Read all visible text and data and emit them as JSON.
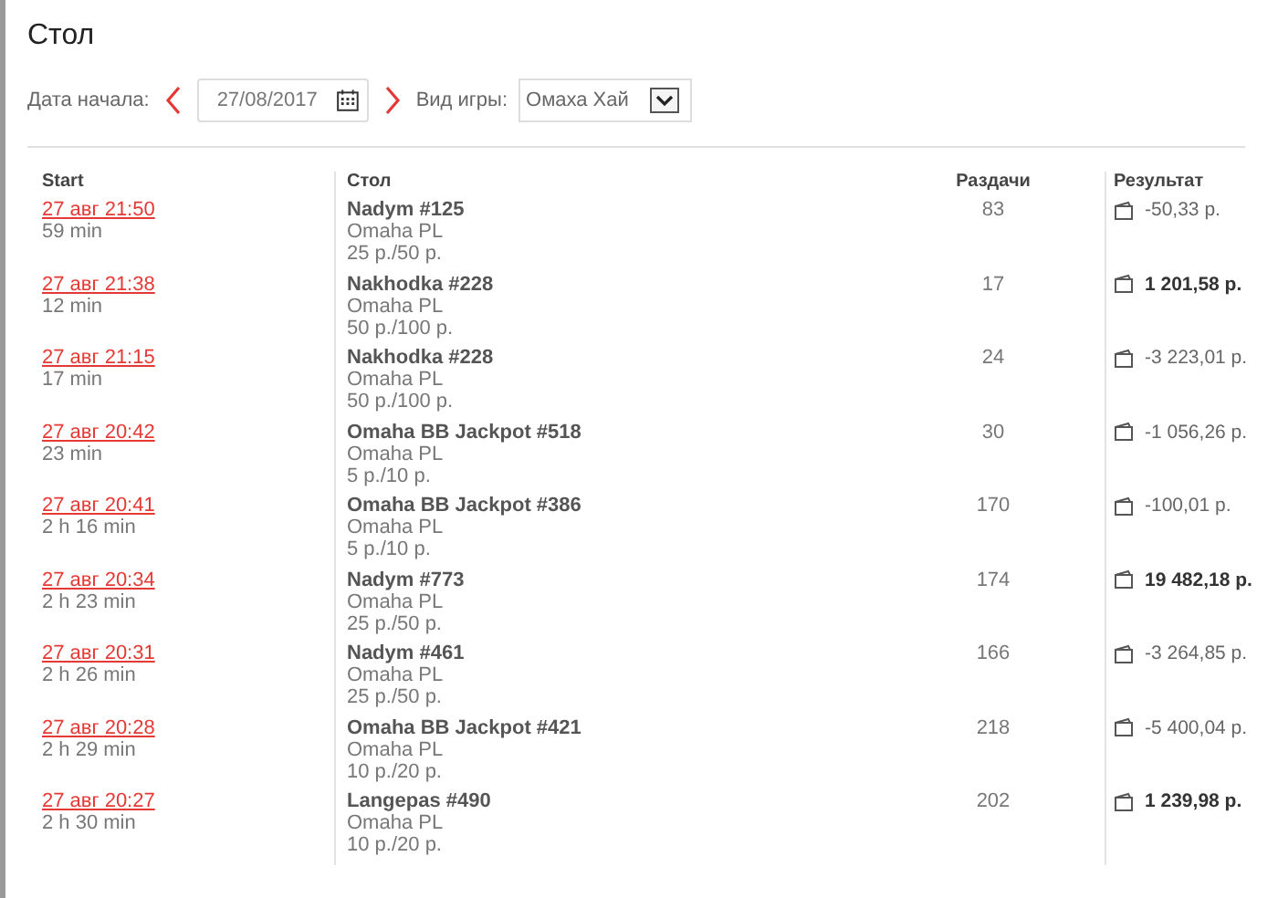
{
  "title": "Стол",
  "filters": {
    "date_label": "Дата начала:",
    "date": "27/08/2017",
    "game_label": "Вид игры:",
    "game": "Омаха Хай"
  },
  "table": {
    "columns": [
      "Start",
      "Стол",
      "Раздачи",
      "Результат"
    ],
    "rows": [
      {
        "start": "27 авг 21:50",
        "duration": "59 min",
        "table": "Nadym #125",
        "game": "Omaha PL",
        "stakes": "25 р./50 р.",
        "hands": "83",
        "result": "-50,33 р.",
        "positive": false
      },
      {
        "start": "27 авг 21:38",
        "duration": "12 min",
        "table": "Nakhodka #228",
        "game": "Omaha PL",
        "stakes": "50 р./100 р.",
        "hands": "17",
        "result": "1 201,58 р.",
        "positive": true
      },
      {
        "start": "27 авг 21:15",
        "duration": "17 min",
        "table": "Nakhodka #228",
        "game": "Omaha PL",
        "stakes": "50 р./100 р.",
        "hands": "24",
        "result": "-3 223,01 р.",
        "positive": false
      },
      {
        "start": "27 авг 20:42",
        "duration": "23 min",
        "table": "Omaha BB Jackpot #518",
        "game": "Omaha PL",
        "stakes": "5 р./10 р.",
        "hands": "30",
        "result": "-1 056,26 р.",
        "positive": false
      },
      {
        "start": "27 авг 20:41",
        "duration": "2 h 16 min",
        "table": "Omaha BB Jackpot #386",
        "game": "Omaha PL",
        "stakes": "5 р./10 р.",
        "hands": "170",
        "result": "-100,01 р.",
        "positive": false
      },
      {
        "start": "27 авг 20:34",
        "duration": "2 h 23 min",
        "table": "Nadym #773",
        "game": "Omaha PL",
        "stakes": "25 р./50 р.",
        "hands": "174",
        "result": "19 482,18 р.",
        "positive": true
      },
      {
        "start": "27 авг 20:31",
        "duration": "2 h 26 min",
        "table": "Nadym #461",
        "game": "Omaha PL",
        "stakes": "25 р./50 р.",
        "hands": "166",
        "result": "-3 264,85 р.",
        "positive": false
      },
      {
        "start": "27 авг 20:28",
        "duration": "2 h 29 min",
        "table": "Omaha BB Jackpot #421",
        "game": "Omaha PL",
        "stakes": "10 р./20 р.",
        "hands": "218",
        "result": "-5 400,04 р.",
        "positive": false
      },
      {
        "start": "27 авг 20:27",
        "duration": "2 h 30 min",
        "table": "Langepas #490",
        "game": "Omaha PL",
        "stakes": "10 р./20 р.",
        "hands": "202",
        "result": "1 239,98 р.",
        "positive": true
      }
    ]
  }
}
